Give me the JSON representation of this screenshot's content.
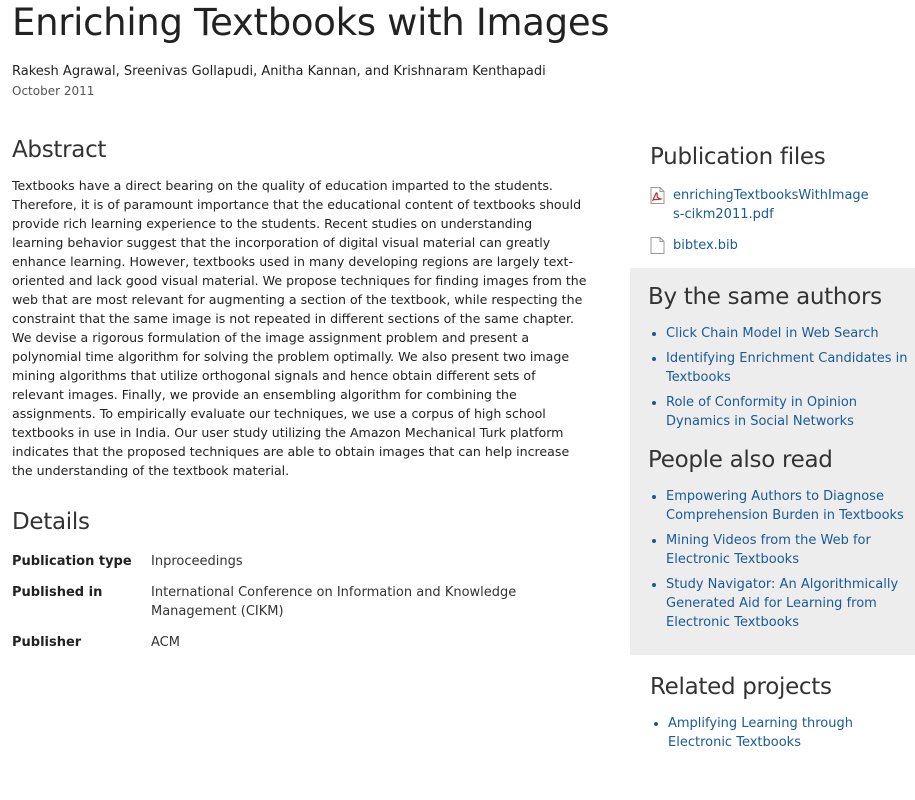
{
  "title": "Enriching Textbooks with Images",
  "authors": "Rakesh Agrawal, Sreenivas Gollapudi, Anitha Kannan, and Krishnaram Kenthapadi",
  "date": "October 2011",
  "abstract": {
    "heading": "Abstract",
    "text": "Textbooks have a direct bearing on the quality of education imparted to the students. Therefore, it is of paramount importance that the educational content of textbooks should provide rich learning experience to the students. Recent studies on understanding learning behavior suggest that the incorporation of digital visual material can greatly enhance learning. However, textbooks used in many developing regions are largely text-oriented and lack good visual material. We propose techniques for finding images from the web that are most relevant for augmenting a section of the textbook, while respecting the constraint that the same image is not repeated in different sections of the same chapter. We devise a rigorous formulation of the image assignment problem and present a polynomial time algorithm for solving the problem optimally. We also present two image mining algorithms that utilize orthogonal signals and hence obtain different sets of relevant images. Finally, we provide an ensembling algorithm for combining the assignments. To empirically evaluate our techniques, we use a corpus of high school textbooks in use in India. Our user study utilizing the Amazon Mechanical Turk platform indicates that the proposed techniques are able to obtain images that can help increase the understanding of the textbook material."
  },
  "details": {
    "heading": "Details",
    "rows": [
      {
        "label": "Publication type",
        "value": "Inproceedings"
      },
      {
        "label": "Published in",
        "value": "International Conference on Information and Knowledge Management (CIKM)"
      },
      {
        "label": "Publisher",
        "value": "ACM"
      }
    ]
  },
  "files": {
    "heading": "Publication files",
    "items": [
      {
        "name": "enrichingTextbooksWithImages-cikm2011.pdf",
        "icon": "pdf-file-icon"
      },
      {
        "name": "bibtex.bib",
        "icon": "text-file-icon"
      }
    ]
  },
  "same_authors": {
    "heading": "By the same authors",
    "items": [
      "Click Chain Model in Web Search",
      "Identifying Enrichment Candidates in Textbooks",
      "Role of Conformity in Opinion Dynamics in Social Networks"
    ]
  },
  "also_read": {
    "heading": "People also read",
    "items": [
      "Empowering Authors to Diagnose Comprehension Burden in Textbooks",
      "Mining Videos from the Web for Electronic Textbooks",
      "Study Navigator: An Algorithmically Generated Aid for Learning from Electronic Textbooks"
    ]
  },
  "related": {
    "heading": "Related projects",
    "items": [
      "Amplifying Learning through Electronic Textbooks"
    ]
  },
  "colors": {
    "link": "#1a5a96",
    "sidebar_bg": "#ededed",
    "pdf_red": "#c0282d"
  }
}
